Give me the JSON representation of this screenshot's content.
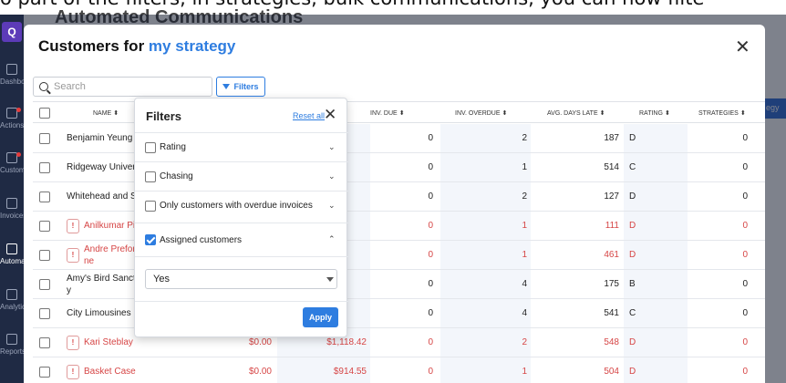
{
  "caption": "o part of the filters, in strategies, bulk communications, you can now filte",
  "background": {
    "title": "Automated Communications",
    "logo": "Q",
    "sidebar": [
      {
        "label": "Dashboard",
        "icon": "home-icon"
      },
      {
        "label": "Actions",
        "icon": "list-icon"
      },
      {
        "label": "Customers",
        "icon": "people-icon"
      },
      {
        "label": "Invoices",
        "icon": "invoice-icon"
      },
      {
        "label": "Automation",
        "icon": "mail-icon"
      },
      {
        "label": "Analytics",
        "icon": "chart-icon"
      },
      {
        "label": "Reports",
        "icon": "report-icon"
      }
    ],
    "right_button": "egy"
  },
  "modal": {
    "title_prefix": "Customers for",
    "title_accent": "my strategy",
    "close_glyph": "✕"
  },
  "search": {
    "placeholder": "Search",
    "value": ""
  },
  "filters_button": "Filters",
  "table": {
    "headers": [
      "NAME",
      "INV. DUE",
      "INV. OVERDUE",
      "AVG. DAYS LATE",
      "RATING",
      "STRATEGIES"
    ],
    "sort_glyph": "⬍",
    "rows": [
      {
        "name": "Benjamin Yeung",
        "warn": false,
        "overdue": false,
        "due_amt": "",
        "overdue_amt": "",
        "inv_due": "0",
        "inv_overdue": "2",
        "avg_days_late": "187",
        "rating": "D",
        "strategies": "0"
      },
      {
        "name": "Ridgeway Univers",
        "warn": false,
        "overdue": false,
        "due_amt": "",
        "overdue_amt": "",
        "inv_due": "0",
        "inv_overdue": "1",
        "avg_days_late": "514",
        "rating": "C",
        "strategies": "0"
      },
      {
        "name": "Whitehead and So",
        "warn": false,
        "overdue": false,
        "due_amt": "",
        "overdue_amt": "",
        "inv_due": "0",
        "inv_overdue": "2",
        "avg_days_late": "127",
        "rating": "D",
        "strategies": "0"
      },
      {
        "name": "Anilkumar Pil",
        "warn": true,
        "overdue": true,
        "due_amt": "",
        "overdue_amt": "",
        "inv_due": "0",
        "inv_overdue": "1",
        "avg_days_late": "111",
        "rating": "D",
        "strategies": "0"
      },
      {
        "name": "Andre Prefon",
        "name2": "ne",
        "warn": true,
        "overdue": true,
        "due_amt": "",
        "overdue_amt": "",
        "inv_due": "0",
        "inv_overdue": "1",
        "avg_days_late": "461",
        "rating": "D",
        "strategies": "0"
      },
      {
        "name": "Amy's Bird Sanctu",
        "name2": "y",
        "warn": false,
        "overdue": false,
        "due_amt": "",
        "overdue_amt": "",
        "inv_due": "0",
        "inv_overdue": "4",
        "avg_days_late": "175",
        "rating": "B",
        "strategies": "0"
      },
      {
        "name": "City Limousines",
        "warn": false,
        "overdue": false,
        "due_amt": "",
        "overdue_amt": "",
        "inv_due": "0",
        "inv_overdue": "4",
        "avg_days_late": "541",
        "rating": "C",
        "strategies": "0"
      },
      {
        "name": "Kari Steblay",
        "warn": true,
        "overdue": true,
        "due_amt": "$0.00",
        "overdue_amt": "$1,118.42",
        "inv_due": "0",
        "inv_overdue": "2",
        "avg_days_late": "548",
        "rating": "D",
        "strategies": "0"
      },
      {
        "name": "Basket Case",
        "warn": true,
        "overdue": true,
        "due_amt": "$0.00",
        "overdue_amt": "$914.55",
        "inv_due": "0",
        "inv_overdue": "1",
        "avg_days_late": "504",
        "rating": "D",
        "strategies": "0"
      }
    ]
  },
  "filter_panel": {
    "title": "Filters",
    "reset_label": "Reset all",
    "close_glyph": "✕",
    "options": [
      {
        "label": "Rating",
        "checked": false,
        "expanded": false
      },
      {
        "label": "Chasing",
        "checked": false,
        "expanded": false
      },
      {
        "label": "Only customers with overdue invoices",
        "checked": false,
        "expanded": false
      },
      {
        "label": "Assigned customers",
        "checked": true,
        "expanded": true
      }
    ],
    "chevron_down": "⌄",
    "chevron_up": "⌃",
    "assigned_select_value": "Yes",
    "apply_label": "Apply"
  },
  "colors": {
    "accent": "#2e7de0",
    "overdue": "#d64545",
    "sidebar": "#1f2a44"
  }
}
